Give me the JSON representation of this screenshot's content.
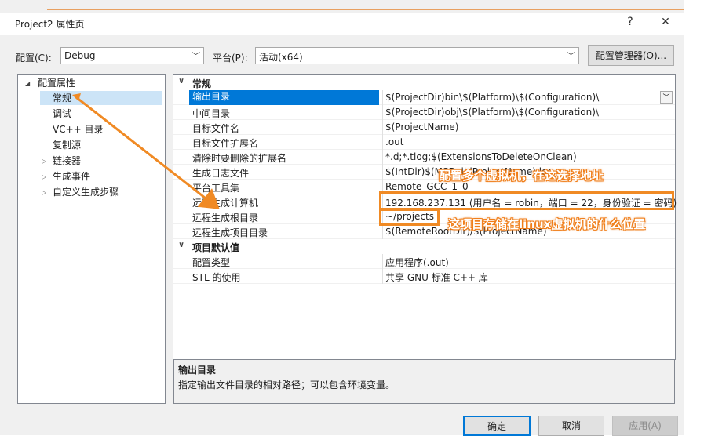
{
  "window": {
    "title": "Project2 属性页",
    "help": "?",
    "close": "✕"
  },
  "toolbar": {
    "config_label": "配置(C):",
    "config_value": "Debug",
    "platform_label": "平台(P):",
    "platform_value": "活动(x64)",
    "config_manager": "配置管理器(O)..."
  },
  "tree": {
    "root": "配置属性",
    "items": [
      "常规",
      "调试",
      "VC++ 目录",
      "复制源",
      "链接器",
      "生成事件",
      "自定义生成步骤"
    ]
  },
  "grid": {
    "cat1": "常规",
    "rows1": [
      {
        "k": "输出目录",
        "v": "$(ProjectDir)bin\\$(Platform)\\$(Configuration)\\"
      },
      {
        "k": "中间目录",
        "v": "$(ProjectDir)obj\\$(Platform)\\$(Configuration)\\"
      },
      {
        "k": "目标文件名",
        "v": "$(ProjectName)"
      },
      {
        "k": "目标文件扩展名",
        "v": ".out"
      },
      {
        "k": "清除时要删除的扩展名",
        "v": "*.d;*.tlog;$(ExtensionsToDeleteOnClean)"
      },
      {
        "k": "生成日志文件",
        "v": "$(IntDir)$(MSBuildProjectName).log"
      },
      {
        "k": "平台工具集",
        "v": "Remote_GCC_1_0"
      },
      {
        "k": "远程生成计算机",
        "v": "192.168.237.131 (用户名 = robin，端口 = 22，身份验证 = 密码)"
      },
      {
        "k": "远程生成根目录",
        "v": "~/projects"
      },
      {
        "k": "远程生成项目目录",
        "v": "$(RemoteRootDir)/$(ProjectName)"
      }
    ],
    "cat2": "项目默认值",
    "rows2": [
      {
        "k": "配置类型",
        "v": "应用程序(.out)"
      },
      {
        "k": "STL 的使用",
        "v": "共享 GNU 标准 C++ 库"
      }
    ]
  },
  "description": {
    "title": "输出目录",
    "text": "指定输出文件目录的相对路径；可以包含环境变量。"
  },
  "buttons": {
    "ok": "确定",
    "cancel": "取消",
    "apply": "应用(A)"
  },
  "annotations": {
    "a1": "配置多个虚拟机，在这选择地址",
    "a2": "这项目存储在linux虚拟机的什么位置"
  },
  "colors": {
    "accent": "#0078d7",
    "annotation": "#f08a24"
  }
}
